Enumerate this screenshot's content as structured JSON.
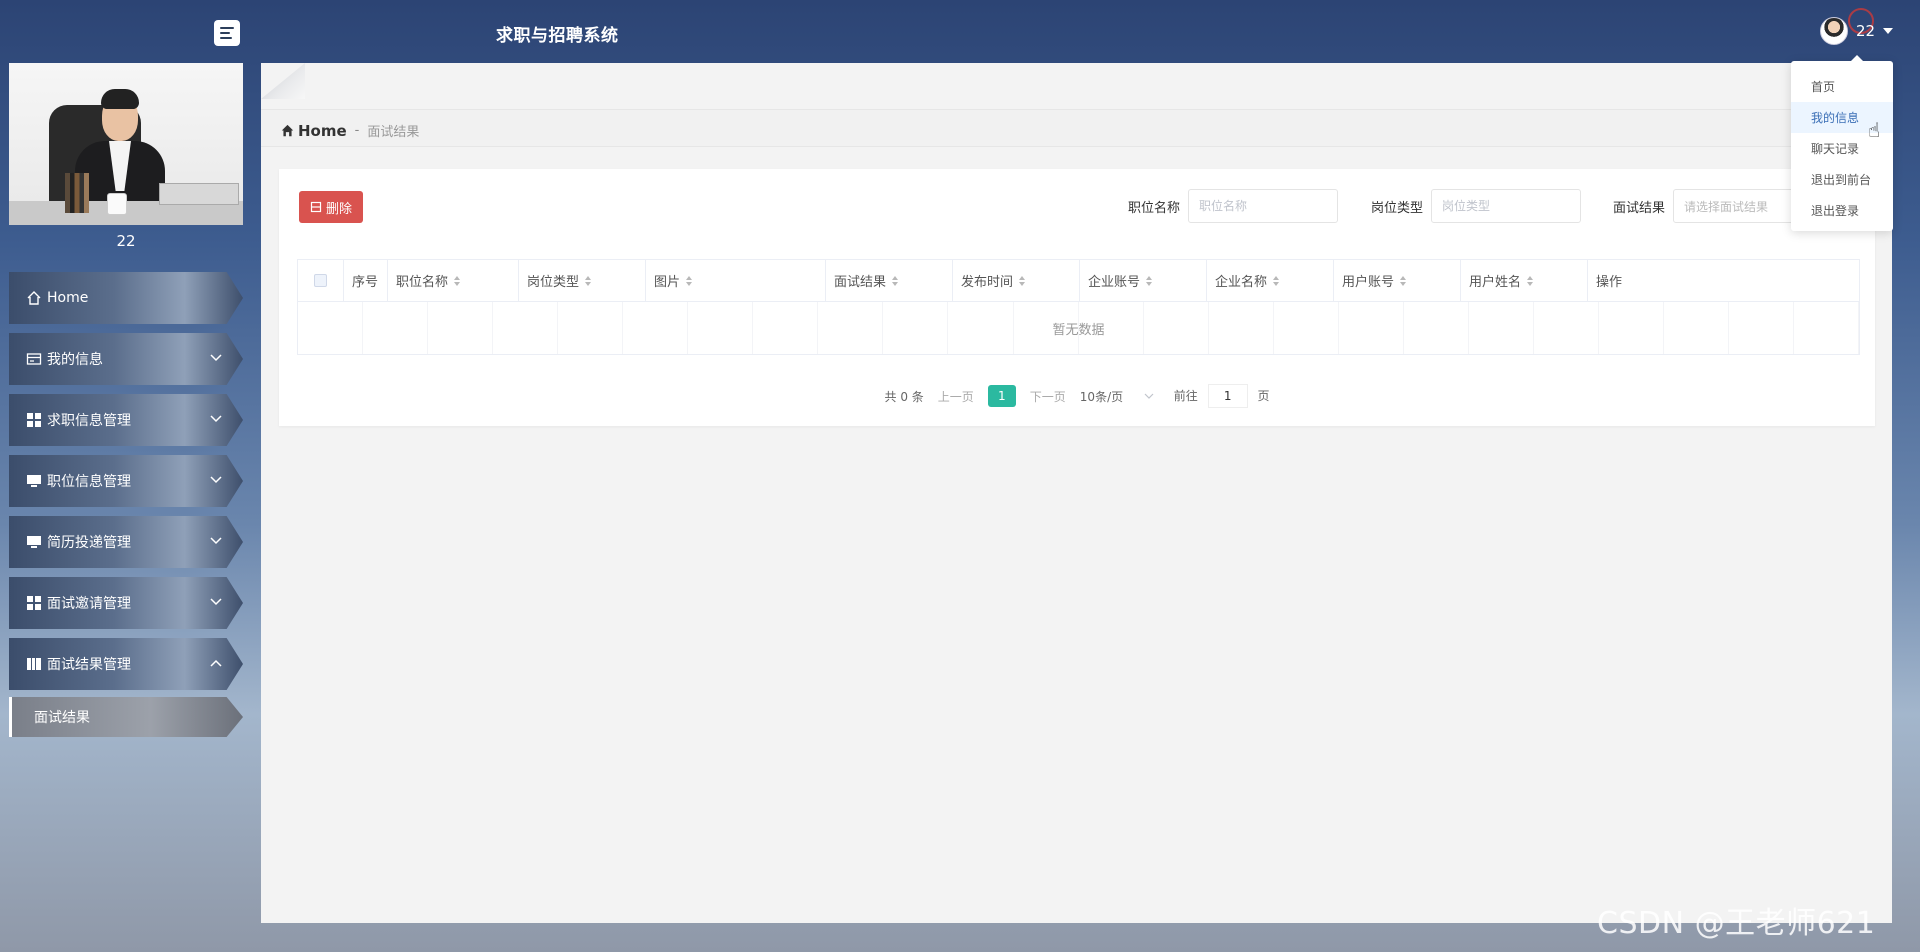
{
  "app": {
    "title": "求职与招聘系统",
    "username": "22"
  },
  "profile": {
    "name": "22"
  },
  "nav": {
    "items": [
      {
        "label": "Home",
        "icon": "home-icon"
      },
      {
        "label": "我的信息",
        "icon": "card-icon"
      },
      {
        "label": "求职信息管理",
        "icon": "grid-icon"
      },
      {
        "label": "职位信息管理",
        "icon": "monitor-icon"
      },
      {
        "label": "简历投递管理",
        "icon": "monitor-icon"
      },
      {
        "label": "面试邀请管理",
        "icon": "grid-icon"
      },
      {
        "label": "面试结果管理",
        "icon": "book-icon"
      }
    ],
    "sub_items": [
      {
        "label": "面试结果"
      }
    ]
  },
  "breadcrumb": {
    "home": "Home",
    "separator": "-",
    "current": "面试结果"
  },
  "toolbar": {
    "delete_label": "删除",
    "filters": [
      {
        "label": "职位名称",
        "placeholder": "职位名称"
      },
      {
        "label": "岗位类型",
        "placeholder": "岗位类型"
      },
      {
        "label": "面试结果",
        "placeholder": "请选择面试结果"
      }
    ]
  },
  "table": {
    "columns": [
      "序号",
      "职位名称",
      "岗位类型",
      "图片",
      "面试结果",
      "发布时间",
      "企业账号",
      "企业名称",
      "用户账号",
      "用户姓名",
      "操作"
    ],
    "empty_text": "暂无数据"
  },
  "pagination": {
    "total": "共 0 条",
    "prev": "上一页",
    "current_page": "1",
    "next": "下一页",
    "page_size": "10条/页",
    "goto_label": "前往",
    "goto_value": "1",
    "page_suffix": "页"
  },
  "user_menu": {
    "items": [
      "首页",
      "我的信息",
      "聊天记录",
      "退出到前台",
      "退出登录"
    ],
    "hovered": "我的信息"
  },
  "watermark": "CSDN @王老师621",
  "colors": {
    "accent": "#2bb9a0",
    "danger": "#d9534f"
  }
}
